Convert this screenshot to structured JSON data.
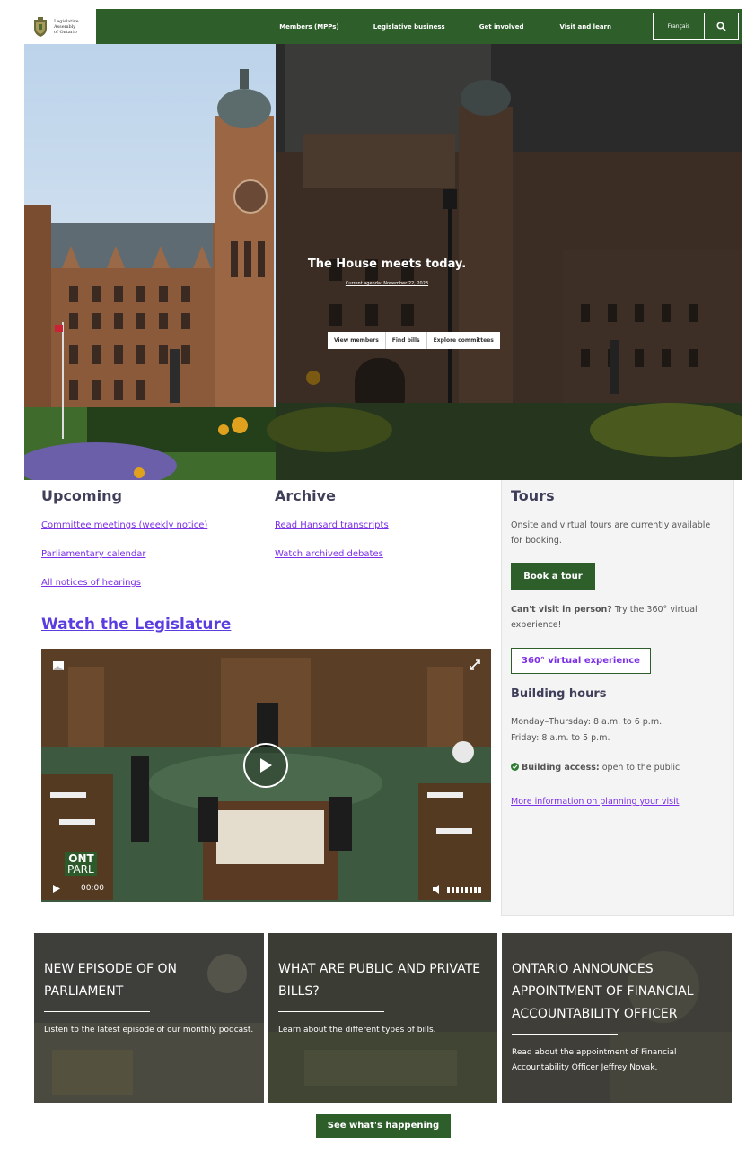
{
  "header": {
    "logo_lines": [
      "Legislative",
      "Assembly",
      "of Ontario"
    ],
    "nav": [
      "Members (MPPs)",
      "Legislative business",
      "Get involved",
      "Visit and learn"
    ],
    "language": "Français",
    "search_icon": "search-icon"
  },
  "hero": {
    "title": "The House meets today.",
    "agenda_link": "Current agenda: November 22, 2023",
    "buttons": [
      "View members",
      "Find bills",
      "Explore committees"
    ]
  },
  "upcoming": {
    "heading": "Upcoming",
    "links": [
      "Committee meetings (weekly notice)",
      "Parliamentary calendar",
      "All notices of hearings"
    ]
  },
  "archive": {
    "heading": "Archive",
    "links": [
      "Read Hansard transcripts",
      "Watch archived debates"
    ]
  },
  "watch": {
    "heading": "Watch the Legislature",
    "logo_top": "ONT",
    "logo_bottom": "PARL",
    "time": "00:00"
  },
  "tours": {
    "heading": "Tours",
    "intro": "Onsite and virtual tours are currently available for booking.",
    "book_button": "Book a tour",
    "cant_visit_bold": "Can't visit in person?",
    "cant_visit_rest": " Try the 360° virtual experience!",
    "virtual_button": "360° virtual experience",
    "hours_heading": "Building hours",
    "hours_line1": "Monday–Thursday: 8 a.m. to 6 p.m.",
    "hours_line2": "Friday: 8 a.m. to 5 p.m.",
    "access_bold": "Building access:",
    "access_rest": " open to the public",
    "more_link": "More information on planning your visit"
  },
  "cards": [
    {
      "title": "NEW EPISODE OF ON PARLIAMENT",
      "text": "Listen to the latest episode of our monthly podcast."
    },
    {
      "title": "WHAT ARE PUBLIC AND PRIVATE BILLS?",
      "text": "Learn about the different types of bills."
    },
    {
      "title": "ONTARIO ANNOUNCES APPOINTMENT OF FINANCIAL ACCOUNTABILITY OFFICER",
      "text": "Read about the appointment of Financial Accountability Officer Jeffrey Novak."
    }
  ],
  "cta": "See what's happening",
  "colors": {
    "brand_green": "#2e5f2b",
    "link_purple": "#7b2fe6",
    "heading": "#3f3f5a"
  }
}
